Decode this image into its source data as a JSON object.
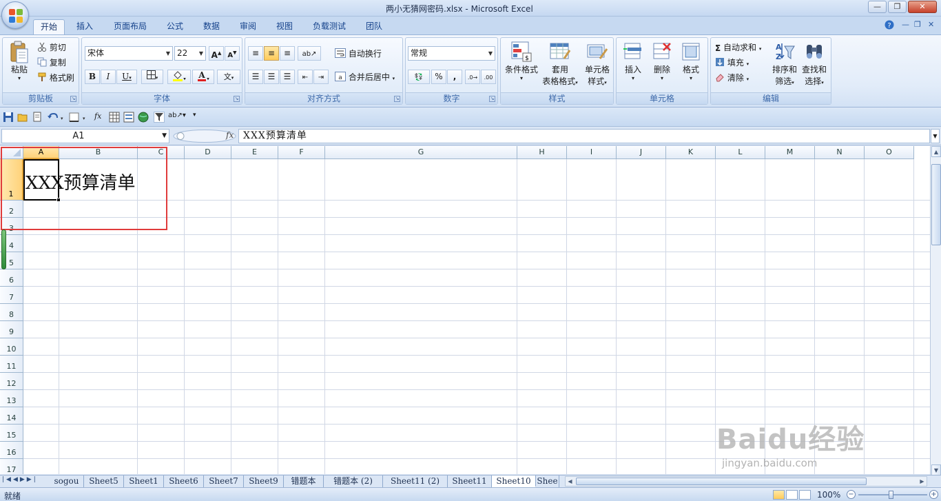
{
  "window": {
    "title": "两小无猜网密码.xlsx - Microsoft Excel"
  },
  "ribbon_tabs": [
    "开始",
    "插入",
    "页面布局",
    "公式",
    "数据",
    "审阅",
    "视图",
    "负载测试",
    "团队"
  ],
  "clipboard": {
    "paste": "粘贴",
    "cut": "剪切",
    "copy": "复制",
    "format_painter": "格式刷",
    "label": "剪贴板"
  },
  "font": {
    "name": "宋体",
    "size": "22",
    "bold": "B",
    "italic": "I",
    "underline": "U",
    "label": "字体"
  },
  "alignment": {
    "wrap_text": "自动换行",
    "merge_center": "合并后居中",
    "label": "对齐方式"
  },
  "number": {
    "format": "常规",
    "percent": "%",
    "comma": ",",
    "label": "数字"
  },
  "styles": {
    "conditional_format": "条件格式",
    "table_format_1": "套用",
    "table_format_2": "表格格式",
    "cell_style_1": "单元格",
    "cell_style_2": "样式",
    "label": "样式"
  },
  "cells": {
    "insert": "插入",
    "delete": "删除",
    "format": "格式",
    "label": "单元格"
  },
  "editing": {
    "autosum": "自动求和",
    "fill": "填充",
    "clear": "清除",
    "sort_filter_1": "排序和",
    "sort_filter_2": "筛选",
    "find_select_1": "查找和",
    "find_select_2": "选择",
    "label": "编辑"
  },
  "formula_bar": {
    "name_box": "A1",
    "fx": "fx",
    "value": "XXX预算清单"
  },
  "grid": {
    "columns": [
      "A",
      "B",
      "C",
      "D",
      "E",
      "F",
      "G",
      "H",
      "I",
      "J",
      "K",
      "L",
      "M",
      "N",
      "O"
    ],
    "rows": [
      "1",
      "2",
      "3",
      "4",
      "5",
      "6",
      "7",
      "8",
      "9",
      "10",
      "11",
      "12",
      "13",
      "14",
      "15",
      "16",
      "17"
    ],
    "a1_text": "XXX预算清单",
    "selected_cell": "A1"
  },
  "sheet_tabs": [
    "sogou",
    "Sheet5",
    "Sheet1",
    "Sheet6",
    "Sheet7",
    "Sheet9",
    "错题本",
    "错题本 (2)",
    "Sheet11 (2)",
    "Sheet11",
    "Sheet10",
    "Shee"
  ],
  "active_sheet": "Sheet10",
  "status": {
    "ready": "就绪",
    "zoom": "100%"
  },
  "watermark": {
    "brand": "Baidu经验",
    "url": "jingyan.baidu.com"
  },
  "colors": {
    "highlight_box": "#e03b3b",
    "ribbon_bg": "#dfe8f6",
    "selected_header": "#ffd27a"
  }
}
